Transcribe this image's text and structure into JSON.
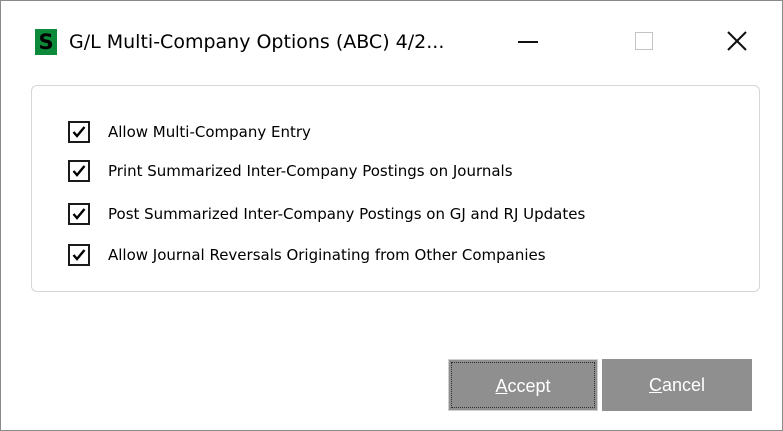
{
  "window": {
    "title": "G/L Multi-Company Options (ABC) 4/2...",
    "app_icon_letter": "S"
  },
  "options": [
    {
      "label": "Allow Multi-Company Entry",
      "checked": true
    },
    {
      "label": "Print Summarized Inter-Company Postings on Journals",
      "checked": true
    },
    {
      "label": "Post Summarized Inter-Company Postings on GJ and RJ Updates",
      "checked": true
    },
    {
      "label": "Allow Journal Reversals Originating from Other Companies",
      "checked": true
    }
  ],
  "buttons": {
    "accept_mnemonic": "A",
    "accept_rest": "ccept",
    "cancel_mnemonic": "C",
    "cancel_rest": "ancel"
  },
  "colors": {
    "button_bg": "#8f8f8f",
    "app_icon_bg": "#0c8a3a"
  }
}
